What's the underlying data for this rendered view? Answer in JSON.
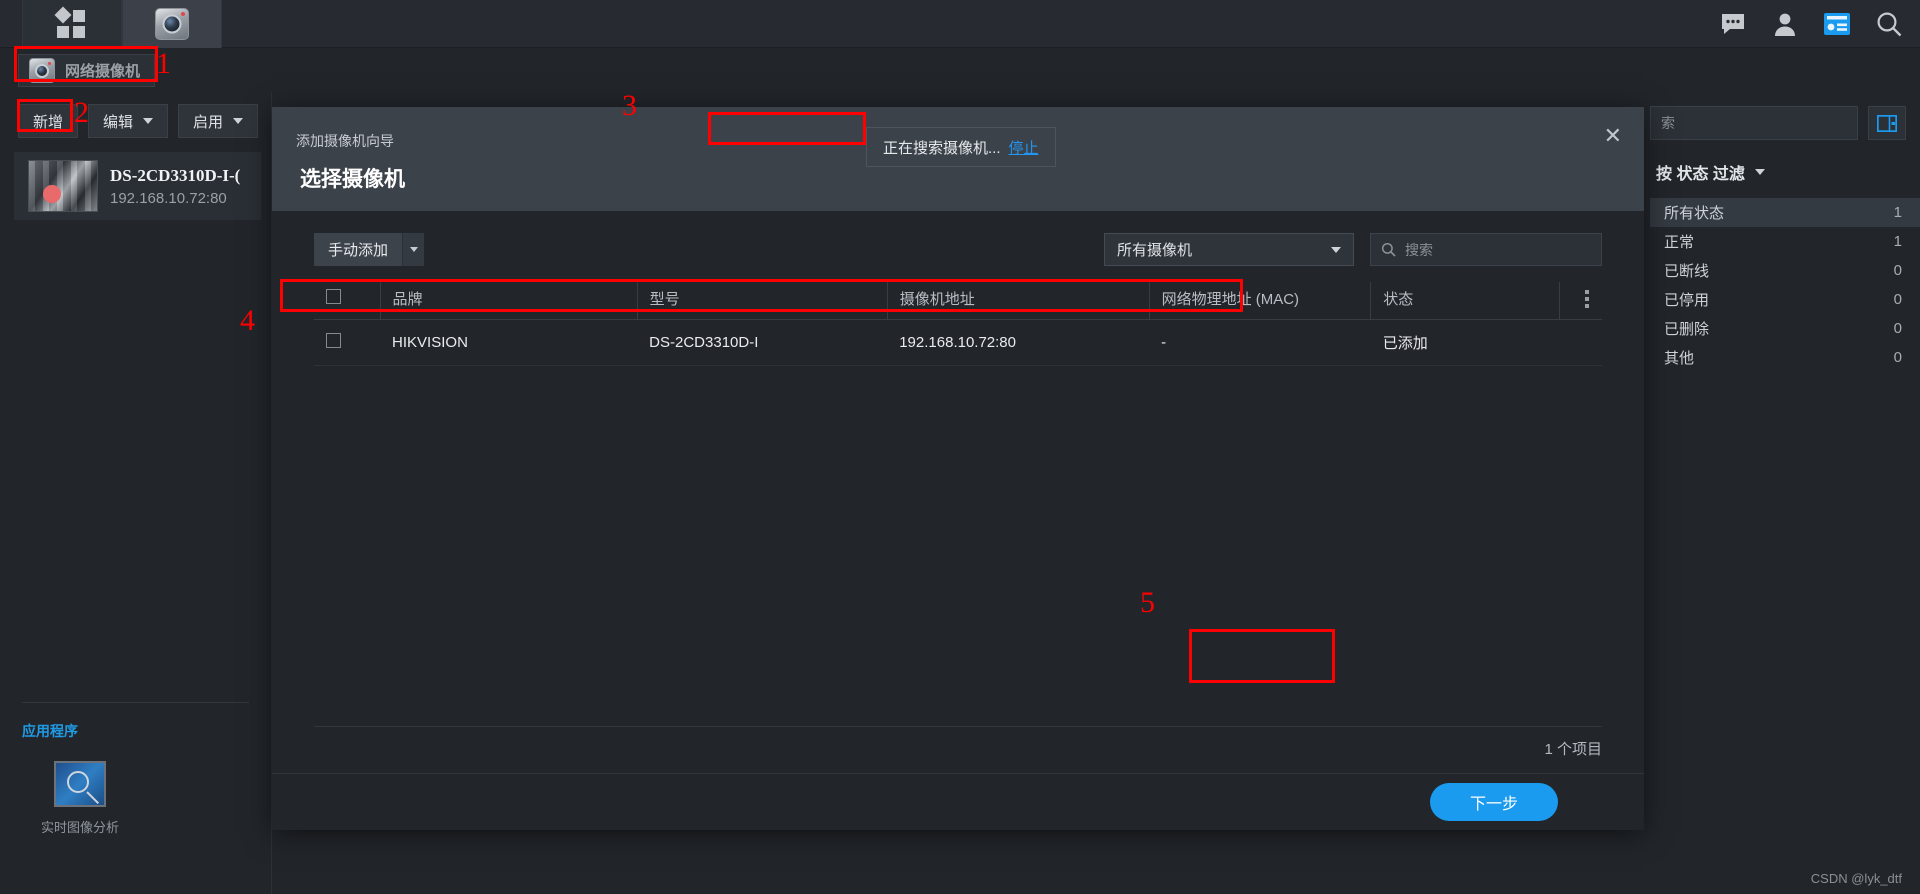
{
  "appbar": {
    "tabs": [
      {
        "name": "dashboard-tab",
        "icon": "grid-icon",
        "active": false
      },
      {
        "name": "camera-tab",
        "icon": "camera-icon",
        "active": true
      }
    ],
    "right_icons": [
      "chat-bubble-icon",
      "user-icon",
      "news-panel-icon",
      "search-icon"
    ]
  },
  "subheader": {
    "page_tab_label": "网络摄像机",
    "window_controls": [
      "?",
      "—",
      "❐",
      "✕"
    ]
  },
  "sidebar": {
    "toolbar": {
      "add_label": "新增",
      "edit_label": "编辑",
      "enable_label": "启用"
    },
    "cameras": [
      {
        "name": "DS-2CD3310D-I-(",
        "ip": "192.168.10.72:80"
      }
    ],
    "apps_title": "应用程序",
    "apps": [
      {
        "label": "实时图像分析",
        "icon": "image-analysis-icon"
      }
    ]
  },
  "right_panel": {
    "search_placeholder": "索",
    "toggle_icon": "panel-toggle-icon",
    "filter_title": "按 状态 过滤",
    "statuses": [
      {
        "label": "所有状态",
        "count": "1",
        "selected": true
      },
      {
        "label": "正常",
        "count": "1",
        "selected": false
      },
      {
        "label": "已断线",
        "count": "0",
        "selected": false
      },
      {
        "label": "已停用",
        "count": "0",
        "selected": false
      },
      {
        "label": "已删除",
        "count": "0",
        "selected": false
      },
      {
        "label": "其他",
        "count": "0",
        "selected": false
      }
    ]
  },
  "modal": {
    "kicker": "添加摄像机向导",
    "title": "选择摄像机",
    "close_icon": "close-icon",
    "search_status_text": "正在搜索摄像机...",
    "search_stop_link": "停止",
    "manual_add_label": "手动添加",
    "filter_value": "所有摄像机",
    "table_search_placeholder": "搜索",
    "table": {
      "columns": [
        "",
        "品牌",
        "型号",
        "摄像机地址",
        "网络物理地址 (MAC)",
        "状态",
        ""
      ],
      "rows": [
        {
          "brand": "HIKVISION",
          "model": "DS-2CD3310D-I",
          "address": "192.168.10.72:80",
          "mac": "-",
          "status": "已添加"
        }
      ]
    },
    "count_text": "1 个项目",
    "next_label": "下一步"
  },
  "annotations": [
    {
      "num": "1"
    },
    {
      "num": "2"
    },
    {
      "num": "3"
    },
    {
      "num": "4"
    },
    {
      "num": "5"
    }
  ],
  "watermark": "CSDN @lyk_dtf",
  "colors": {
    "accent": "#1a9bf0",
    "link": "#2196f3",
    "annotation": "#ff0000",
    "panel_bg": "#22262b",
    "modal_head": "#3c424a"
  }
}
